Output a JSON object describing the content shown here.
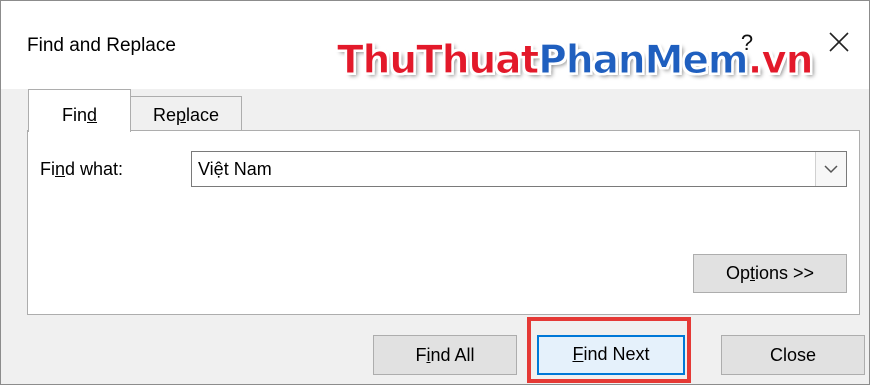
{
  "dialog": {
    "title": "Find and Replace",
    "help_label": "?",
    "close_icon": "close-icon"
  },
  "watermark": {
    "part1": "ThuThuat",
    "part2": "PhanMem",
    "part3": ".vn"
  },
  "tabs": {
    "find": {
      "pre": "Fin",
      "mnemonic": "d",
      "post": ""
    },
    "replace": {
      "pre": "Re",
      "mnemonic": "p",
      "post": "lace"
    }
  },
  "find_what": {
    "label_pre": "Fi",
    "label_mnemonic": "n",
    "label_post": "d what:",
    "value": "Việt Nam"
  },
  "buttons": {
    "options": {
      "pre": "Op",
      "mnemonic": "t",
      "post": "ions >>"
    },
    "find_all": {
      "pre": "F",
      "mnemonic": "i",
      "post": "nd All"
    },
    "find_next": {
      "pre": "",
      "mnemonic": "F",
      "post": "ind Next"
    },
    "close": {
      "label": "Close"
    }
  },
  "colors": {
    "watermark_red": "#e3192a",
    "watermark_blue": "#1f5fbf",
    "highlight": "#e53935",
    "default_button_border": "#0078d7"
  }
}
